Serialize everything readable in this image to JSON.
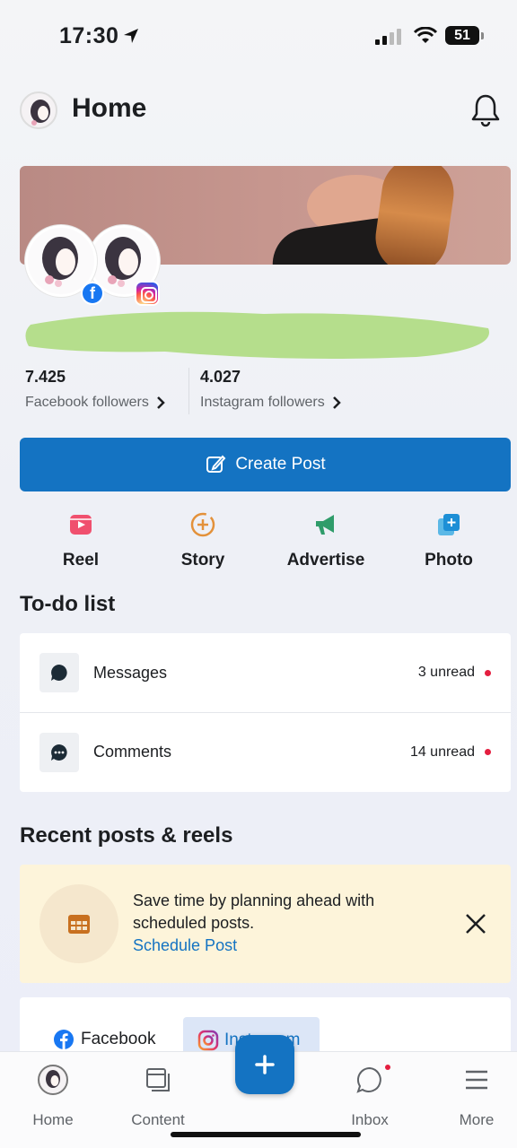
{
  "status_bar": {
    "time": "17:30",
    "battery": "51"
  },
  "header": {
    "title": "Home"
  },
  "stats": {
    "facebook": {
      "count": "7.425",
      "label": "Facebook followers"
    },
    "instagram": {
      "count": "4.027",
      "label": "Instagram followers"
    }
  },
  "create_post": {
    "label": "Create Post"
  },
  "actions": [
    {
      "label": "Reel",
      "icon": "reel-icon"
    },
    {
      "label": "Story",
      "icon": "story-icon"
    },
    {
      "label": "Advertise",
      "icon": "megaphone-icon"
    },
    {
      "label": "Photo",
      "icon": "photo-icon"
    }
  ],
  "todo": {
    "title": "To-do list",
    "items": [
      {
        "label": "Messages",
        "count": "3 unread"
      },
      {
        "label": "Comments",
        "count": "14 unread"
      }
    ]
  },
  "recent": {
    "title": "Recent posts & reels",
    "tip_text": "Save time by planning ahead with scheduled posts.",
    "tip_link": "Schedule Post",
    "tabs": [
      {
        "label": "Facebook"
      },
      {
        "label": "Instagram"
      }
    ]
  },
  "bottom_nav": [
    {
      "label": "Home"
    },
    {
      "label": "Content"
    },
    {
      "label": "Inbox"
    },
    {
      "label": "More"
    }
  ],
  "colors": {
    "primary": "#1473c2",
    "unread_dot": "#e41e3f",
    "tip_bg": "#fdf4da",
    "redaction": "#b5de8c"
  }
}
